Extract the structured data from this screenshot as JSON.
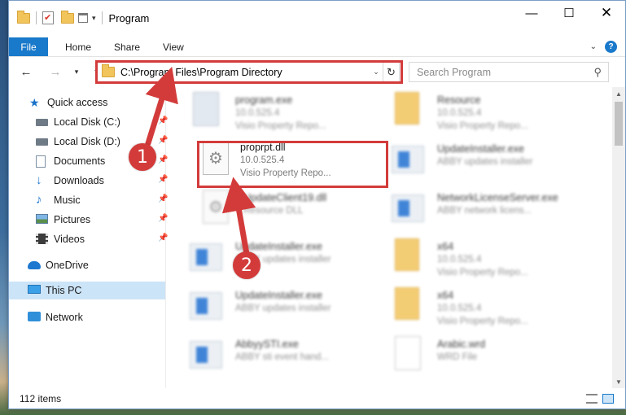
{
  "window": {
    "title": "Program",
    "controls": {
      "minimize": "—",
      "maximize": "☐",
      "close": "✕"
    }
  },
  "ribbon": {
    "tabs": [
      "File",
      "Home",
      "Share",
      "View"
    ]
  },
  "navigation": {
    "address": "C:\\Program Files\\Program Directory",
    "search_placeholder": "Search Program"
  },
  "sidebar": {
    "items": [
      {
        "label": "Quick access",
        "icon": "star-icon"
      },
      {
        "label": "Local Disk (C:)",
        "icon": "disk-icon",
        "pinned": true
      },
      {
        "label": "Local Disk (D:)",
        "icon": "disk-icon",
        "pinned": true
      },
      {
        "label": "Documents",
        "icon": "documents-icon",
        "pinned": true
      },
      {
        "label": "Downloads",
        "icon": "downloads-icon",
        "pinned": true
      },
      {
        "label": "Music",
        "icon": "music-icon",
        "pinned": true
      },
      {
        "label": "Pictures",
        "icon": "pictures-icon",
        "pinned": true
      },
      {
        "label": "Videos",
        "icon": "videos-icon",
        "pinned": true
      },
      {
        "label": "OneDrive",
        "icon": "onedrive-icon"
      },
      {
        "label": "This PC",
        "icon": "this-pc-icon",
        "selected": true
      },
      {
        "label": "Network",
        "icon": "network-icon"
      }
    ]
  },
  "files": [
    {
      "name": "program.exe",
      "line1": "10.0.525.4",
      "line2": "Visio Property Repo...",
      "icon": "program-exe-icon"
    },
    {
      "name": "Resource",
      "line1": "10.0.525.4",
      "line2": "Visio Property Repo...",
      "icon": "folder-icon"
    },
    {
      "name": "proprpt.dll",
      "line1": "10.0.525.4",
      "line2": "Visio Property Repo...",
      "icon": "dll-icon"
    },
    {
      "name": "UpdateInstaller.exe",
      "line1": "ABBY updates installer",
      "line2": "",
      "icon": "exe-icon"
    },
    {
      "name": "UpdateClient19.dll",
      "line1": "Resource DLL",
      "line2": "",
      "icon": "dll-icon"
    },
    {
      "name": "NetworkLicenseServer.exe",
      "line1": "ABBY network licens...",
      "line2": "",
      "icon": "exe-icon"
    },
    {
      "name": "UpdateInstaller.exe",
      "line1": "ABBY updates installer",
      "line2": "",
      "icon": "exe-icon"
    },
    {
      "name": "x64",
      "line1": "10.0.525.4",
      "line2": "Visio Property Repo...",
      "icon": "folder-icon"
    },
    {
      "name": "UpdateInstaller.exe",
      "line1": "ABBY updates installer",
      "line2": "",
      "icon": "exe-icon"
    },
    {
      "name": "x64",
      "line1": "10.0.525.4",
      "line2": "Visio Property Repo...",
      "icon": "folder-icon"
    },
    {
      "name": "AbbyySTI.exe",
      "line1": "ABBY sti event hand...",
      "line2": "",
      "icon": "exe-icon"
    },
    {
      "name": "Arabic.wrd",
      "line1": "WRD File",
      "line2": "",
      "icon": "document-icon"
    }
  ],
  "status": {
    "item_count": "112 items"
  },
  "callouts": {
    "step1": "1",
    "step2": "2"
  },
  "colors": {
    "accent": "#1979ca",
    "highlight": "#d33b3b",
    "selected_bg": "#cce4f7"
  }
}
